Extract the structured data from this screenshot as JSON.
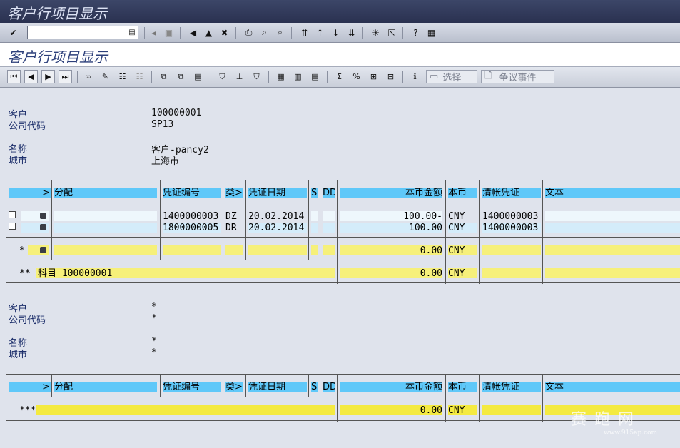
{
  "window": {
    "title": "客户行项目显示"
  },
  "screen": {
    "title": "客户行项目显示"
  },
  "toolbar": {
    "selection_label": "选择",
    "dispute_label": "争议事件"
  },
  "block1": {
    "customer_label": "客户",
    "customer_value": "100000001",
    "company_label": "公司代码",
    "company_value": "SP13",
    "name_label": "名称",
    "name_value": "客户-pancy2",
    "city_label": "城市",
    "city_value": "上海市"
  },
  "columns": {
    "assignment": "分配",
    "doc_no": "凭证编号",
    "type": "类",
    "doc_date": "凭证日期",
    "s": "S",
    "dd": "DD",
    "amount": "本币金额",
    "currency": "本币",
    "clearing": "清帐凭证",
    "text": "文本"
  },
  "rows": [
    {
      "doc_no": "1400000003",
      "type": "DZ",
      "date": "20.02.2014",
      "amount": "100.00-",
      "currency": "CNY",
      "clearing": "1400000003"
    },
    {
      "doc_no": "1800000005",
      "type": "DR",
      "date": "20.02.2014",
      "amount": "100.00",
      "currency": "CNY",
      "clearing": "1400000003"
    }
  ],
  "subtotal": {
    "marker": "*",
    "amount": "0.00",
    "currency": "CNY"
  },
  "account_total": {
    "marker": "**",
    "label": "科目 100000001",
    "amount": "0.00",
    "currency": "CNY"
  },
  "block2": {
    "customer_label": "客户",
    "customer_value": "*",
    "company_label": "公司代码",
    "company_value": "*",
    "name_label": "名称",
    "name_value": "*",
    "city_label": "城市",
    "city_value": "*"
  },
  "grand_total": {
    "marker": "***",
    "amount": "0.00",
    "currency": "CNY"
  },
  "watermark": {
    "main": "赛 跑 网",
    "sub": "www.915ap.com"
  }
}
